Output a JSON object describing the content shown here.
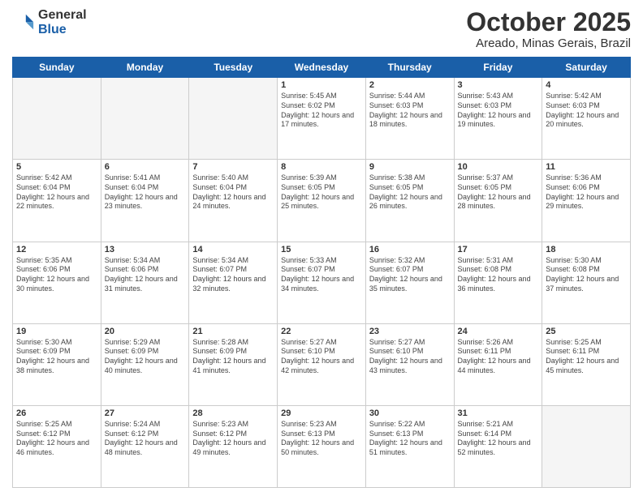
{
  "logo": {
    "line1": "General",
    "line2": "Blue"
  },
  "header": {
    "month": "October 2025",
    "location": "Areado, Minas Gerais, Brazil"
  },
  "weekdays": [
    "Sunday",
    "Monday",
    "Tuesday",
    "Wednesday",
    "Thursday",
    "Friday",
    "Saturday"
  ],
  "weeks": [
    [
      {
        "day": "",
        "info": ""
      },
      {
        "day": "",
        "info": ""
      },
      {
        "day": "",
        "info": ""
      },
      {
        "day": "1",
        "info": "Sunrise: 5:45 AM\nSunset: 6:02 PM\nDaylight: 12 hours\nand 17 minutes."
      },
      {
        "day": "2",
        "info": "Sunrise: 5:44 AM\nSunset: 6:03 PM\nDaylight: 12 hours\nand 18 minutes."
      },
      {
        "day": "3",
        "info": "Sunrise: 5:43 AM\nSunset: 6:03 PM\nDaylight: 12 hours\nand 19 minutes."
      },
      {
        "day": "4",
        "info": "Sunrise: 5:42 AM\nSunset: 6:03 PM\nDaylight: 12 hours\nand 20 minutes."
      }
    ],
    [
      {
        "day": "5",
        "info": "Sunrise: 5:42 AM\nSunset: 6:04 PM\nDaylight: 12 hours\nand 22 minutes."
      },
      {
        "day": "6",
        "info": "Sunrise: 5:41 AM\nSunset: 6:04 PM\nDaylight: 12 hours\nand 23 minutes."
      },
      {
        "day": "7",
        "info": "Sunrise: 5:40 AM\nSunset: 6:04 PM\nDaylight: 12 hours\nand 24 minutes."
      },
      {
        "day": "8",
        "info": "Sunrise: 5:39 AM\nSunset: 6:05 PM\nDaylight: 12 hours\nand 25 minutes."
      },
      {
        "day": "9",
        "info": "Sunrise: 5:38 AM\nSunset: 6:05 PM\nDaylight: 12 hours\nand 26 minutes."
      },
      {
        "day": "10",
        "info": "Sunrise: 5:37 AM\nSunset: 6:05 PM\nDaylight: 12 hours\nand 28 minutes."
      },
      {
        "day": "11",
        "info": "Sunrise: 5:36 AM\nSunset: 6:06 PM\nDaylight: 12 hours\nand 29 minutes."
      }
    ],
    [
      {
        "day": "12",
        "info": "Sunrise: 5:35 AM\nSunset: 6:06 PM\nDaylight: 12 hours\nand 30 minutes."
      },
      {
        "day": "13",
        "info": "Sunrise: 5:34 AM\nSunset: 6:06 PM\nDaylight: 12 hours\nand 31 minutes."
      },
      {
        "day": "14",
        "info": "Sunrise: 5:34 AM\nSunset: 6:07 PM\nDaylight: 12 hours\nand 32 minutes."
      },
      {
        "day": "15",
        "info": "Sunrise: 5:33 AM\nSunset: 6:07 PM\nDaylight: 12 hours\nand 34 minutes."
      },
      {
        "day": "16",
        "info": "Sunrise: 5:32 AM\nSunset: 6:07 PM\nDaylight: 12 hours\nand 35 minutes."
      },
      {
        "day": "17",
        "info": "Sunrise: 5:31 AM\nSunset: 6:08 PM\nDaylight: 12 hours\nand 36 minutes."
      },
      {
        "day": "18",
        "info": "Sunrise: 5:30 AM\nSunset: 6:08 PM\nDaylight: 12 hours\nand 37 minutes."
      }
    ],
    [
      {
        "day": "19",
        "info": "Sunrise: 5:30 AM\nSunset: 6:09 PM\nDaylight: 12 hours\nand 38 minutes."
      },
      {
        "day": "20",
        "info": "Sunrise: 5:29 AM\nSunset: 6:09 PM\nDaylight: 12 hours\nand 40 minutes."
      },
      {
        "day": "21",
        "info": "Sunrise: 5:28 AM\nSunset: 6:09 PM\nDaylight: 12 hours\nand 41 minutes."
      },
      {
        "day": "22",
        "info": "Sunrise: 5:27 AM\nSunset: 6:10 PM\nDaylight: 12 hours\nand 42 minutes."
      },
      {
        "day": "23",
        "info": "Sunrise: 5:27 AM\nSunset: 6:10 PM\nDaylight: 12 hours\nand 43 minutes."
      },
      {
        "day": "24",
        "info": "Sunrise: 5:26 AM\nSunset: 6:11 PM\nDaylight: 12 hours\nand 44 minutes."
      },
      {
        "day": "25",
        "info": "Sunrise: 5:25 AM\nSunset: 6:11 PM\nDaylight: 12 hours\nand 45 minutes."
      }
    ],
    [
      {
        "day": "26",
        "info": "Sunrise: 5:25 AM\nSunset: 6:12 PM\nDaylight: 12 hours\nand 46 minutes."
      },
      {
        "day": "27",
        "info": "Sunrise: 5:24 AM\nSunset: 6:12 PM\nDaylight: 12 hours\nand 48 minutes."
      },
      {
        "day": "28",
        "info": "Sunrise: 5:23 AM\nSunset: 6:12 PM\nDaylight: 12 hours\nand 49 minutes."
      },
      {
        "day": "29",
        "info": "Sunrise: 5:23 AM\nSunset: 6:13 PM\nDaylight: 12 hours\nand 50 minutes."
      },
      {
        "day": "30",
        "info": "Sunrise: 5:22 AM\nSunset: 6:13 PM\nDaylight: 12 hours\nand 51 minutes."
      },
      {
        "day": "31",
        "info": "Sunrise: 5:21 AM\nSunset: 6:14 PM\nDaylight: 12 hours\nand 52 minutes."
      },
      {
        "day": "",
        "info": ""
      }
    ]
  ]
}
